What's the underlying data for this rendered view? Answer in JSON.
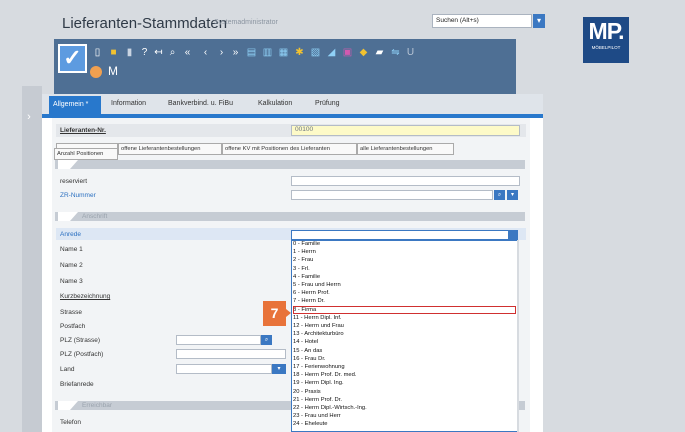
{
  "window": {
    "title": "Lieferanten-Stammdaten",
    "subtitle": "Systemadministrator",
    "search_placeholder": "Suchen (Alt+s)"
  },
  "logo": {
    "text": "MP.",
    "subtext": "MÖBELPILOT"
  },
  "toolbar": {
    "letter_m": "M"
  },
  "tabs": [
    {
      "label": "Allgemein *",
      "active": true
    },
    {
      "label": "Information"
    },
    {
      "label": "Bankverbind. u. FiBu"
    },
    {
      "label": "Kalkulation"
    },
    {
      "label": "Prüfung"
    }
  ],
  "header_row": {
    "label": "Lieferanten-Nr.",
    "value": "00100"
  },
  "subtabs": [
    "offene Lieferantenbestellungen",
    "offene KV mit Positionen des Lieferanten",
    "alle Lieferantenbestellungen"
  ],
  "subtab_extra": "Anzahl Positionen",
  "section1": {
    "fields": [
      {
        "label": "reserviert"
      },
      {
        "label": "ZR-Nummer"
      }
    ]
  },
  "section_anschrift": {
    "title": "Anschrift",
    "fields": [
      "Anrede",
      "Name 1",
      "Name 2",
      "Name 3",
      "Kurzbezeichnung",
      "Strasse",
      "Postfach",
      "PLZ (Strasse)",
      "PLZ (Postfach)",
      "Land",
      "Briefanrede"
    ]
  },
  "section_erreichbar": {
    "title": "Erreichbar",
    "fields": [
      "Telefon"
    ]
  },
  "dropdown_options": [
    "0 - Familie",
    "1 - Herrn",
    "2 - Frau",
    "3 - Frl.",
    "4 - Familie",
    "5 - Frau und Herrn",
    "6 - Herrn Prof.",
    "7 - Herrn Dr.",
    "8 - Firma",
    "11 - Herrn Dipl. Inf.",
    "12 - Herrn und Frau",
    "13 - Architekturbüro",
    "14 - Hotel",
    "15 - An das",
    "16 - Frau Dr.",
    "17 - Ferienwohnung",
    "18 - Herrn Prof. Dr. med.",
    "19 - Herrn Dipl. Ing.",
    "20 - Praxis",
    "21 - Herrn Prof. Dr.",
    "22 - Herrn Dipl.-Wirtsch.-Ing.",
    "23 - Frau und Herr",
    "24 - Eheleute"
  ],
  "highlighted_option": "8 - Firma",
  "step_marker": "7",
  "colors": {
    "accent": "#2878cc",
    "toolbar": "#4e6f94",
    "highlight": "#d03030",
    "step": "#e8733a"
  }
}
